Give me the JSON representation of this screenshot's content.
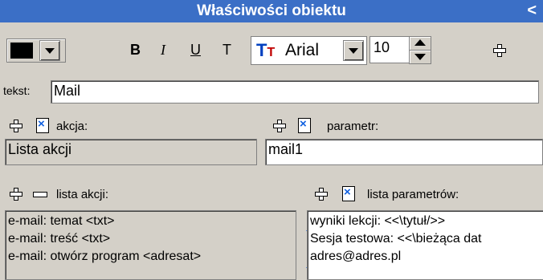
{
  "panel": {
    "title": "Właściwości obiektu",
    "collapse": "<"
  },
  "toolbar": {
    "color": "#000000",
    "bold": "B",
    "italic": "I",
    "underline": "U",
    "text_tool": "T",
    "font_name": "Arial",
    "font_size": "10"
  },
  "text_row": {
    "label": "tekst:",
    "value": "Mail"
  },
  "action": {
    "label": "akcja:",
    "value": "Lista akcji"
  },
  "param": {
    "label": "parametr:",
    "value": "mail1"
  },
  "actions_list": {
    "label": "lista akcji:",
    "items": [
      "e-mail: temat <txt>",
      "e-mail: treść <txt>",
      "e-mail: otwórz program <adresat>"
    ]
  },
  "params_list": {
    "label": "lista parametrów:",
    "items": [
      "wyniki lekcji: <<\\tytuł/>>",
      "Sesja testowa: <<\\bieżąca dat",
      "adres@adres.pl"
    ]
  }
}
